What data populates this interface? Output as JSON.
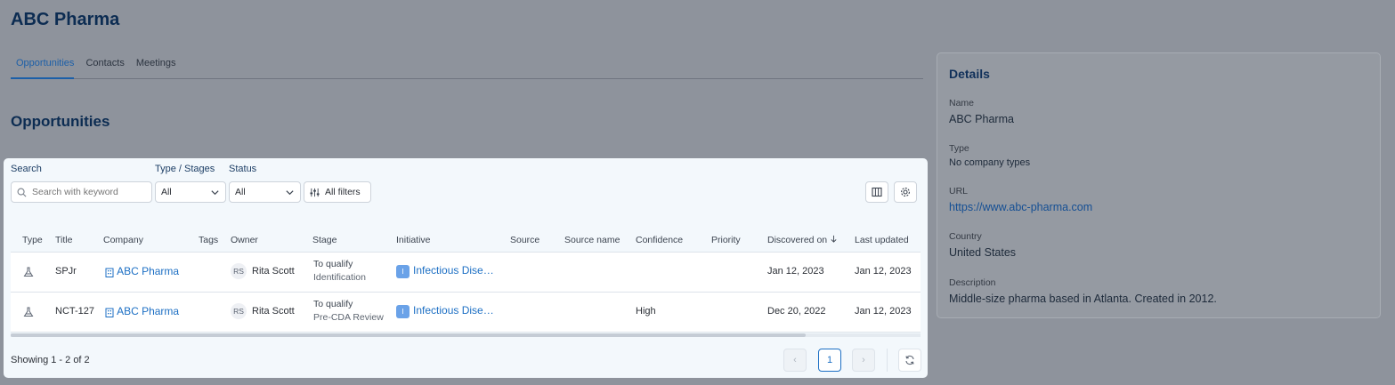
{
  "page": {
    "title": "ABC Pharma"
  },
  "tabs": [
    {
      "label": "Opportunities",
      "active": true
    },
    {
      "label": "Contacts",
      "active": false
    },
    {
      "label": "Meetings",
      "active": false
    }
  ],
  "section": {
    "title": "Opportunities"
  },
  "filters": {
    "search_label": "Search",
    "search_placeholder": "Search with keyword",
    "type_label": "Type / Stages",
    "type_value": "All",
    "status_label": "Status",
    "status_value": "All",
    "all_filters_label": "All filters"
  },
  "table": {
    "columns": [
      "Type",
      "Title",
      "Company",
      "Tags",
      "Owner",
      "Stage",
      "Initiative",
      "Source",
      "Source name",
      "Confidence",
      "Priority",
      "Discovered on",
      "Last updated"
    ],
    "rows": [
      {
        "title": "SPJr",
        "company": "ABC Pharma",
        "owner_initials": "RS",
        "owner": "Rita Scott",
        "stage": "To qualify",
        "substage": "Identification",
        "initiative_badge": "I",
        "initiative": "Infectious Dise…",
        "confidence": "",
        "discovered": "Jan 12, 2023",
        "updated": "Jan 12, 2023"
      },
      {
        "title": "NCT-127",
        "company": "ABC Pharma",
        "owner_initials": "RS",
        "owner": "Rita Scott",
        "stage": "To qualify",
        "substage": "Pre-CDA Review",
        "initiative_badge": "I",
        "initiative": "Infectious Dise…",
        "confidence": "High",
        "discovered": "Dec 20, 2022",
        "updated": "Jan 12, 2023"
      }
    ]
  },
  "footer": {
    "showing": "Showing 1 - 2 of 2",
    "prev": "‹",
    "page": "1",
    "next": "›"
  },
  "details": {
    "title": "Details",
    "name_label": "Name",
    "name": "ABC Pharma",
    "type_label": "Type",
    "type": "No company types",
    "url_label": "URL",
    "url": "https://www.abc-pharma.com",
    "country_label": "Country",
    "country": "United States",
    "description_label": "Description",
    "description": "Middle-size pharma based in Atlanta. Created in 2012."
  },
  "colors": {
    "accent": "#1c6fc4",
    "heading": "#0c2c52",
    "overlay": "#8e939c"
  }
}
